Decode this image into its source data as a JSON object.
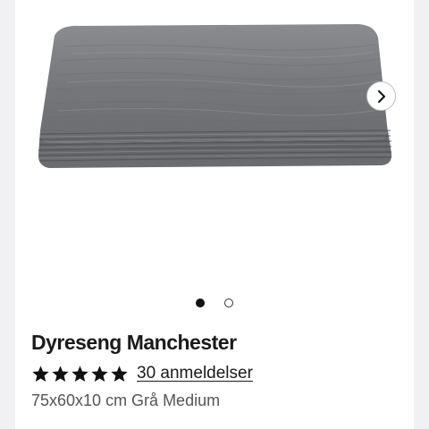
{
  "product": {
    "name": "Dyreseng Manchester",
    "rating": 5,
    "rating_max": 5,
    "reviews_text": "30 anmeldelser",
    "variant": "75x60x10 cm Grå Medium",
    "image_icon": "pet-bed-image"
  },
  "gallery": {
    "current_slide": 1,
    "total_slides": 2,
    "next_icon": "chevron-right-icon"
  },
  "colors": {
    "page_background": "#f1f1f3",
    "card_background": "#ffffff",
    "text_primary": "#1a1a1a",
    "text_secondary": "#555555",
    "star": "#111111",
    "bed_gray": "#6e7074"
  }
}
